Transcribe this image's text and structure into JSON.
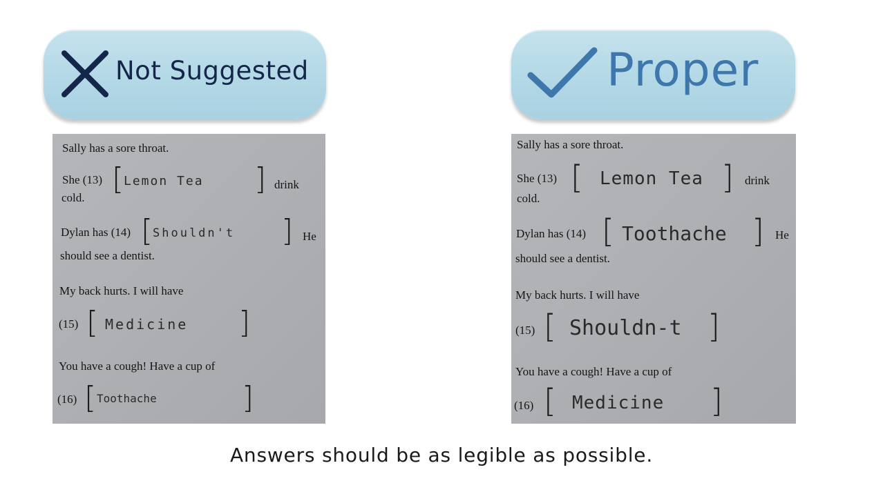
{
  "labels": {
    "left": "Not Suggested",
    "right": "Proper"
  },
  "icons": {
    "left": "x-mark-icon",
    "right": "check-mark-icon"
  },
  "colors": {
    "pill_fill": "#b8dae8",
    "left_label": "#14274a",
    "right_label": "#3d77ab"
  },
  "worksheet": {
    "line1": "Sally has a sore throat.",
    "q13_prefix": "She (13)",
    "q13_suffix": "drink",
    "q13_line2": "cold.",
    "q14_prefix": "Dylan has (14)",
    "q14_suffix": "He",
    "q14_line2": "should see a dentist.",
    "q15_line1": "My back hurts. I will have",
    "q15_prefix": "(15)",
    "q16_line1": "You have a cough! Have a cup of",
    "q16_prefix": "(16)",
    "bracket_open": "[",
    "bracket_close": "]"
  },
  "answers_left": {
    "q13": "Lemon Tea",
    "q14": "Shouldn't",
    "q15": "Medicine",
    "q16": "Toothache"
  },
  "answers_right": {
    "q13": "Lemon Tea",
    "q14": "Toothache",
    "q15": "Shouldn-t",
    "q16": "Medicine"
  },
  "caption": "Answers should be as legible as possible."
}
